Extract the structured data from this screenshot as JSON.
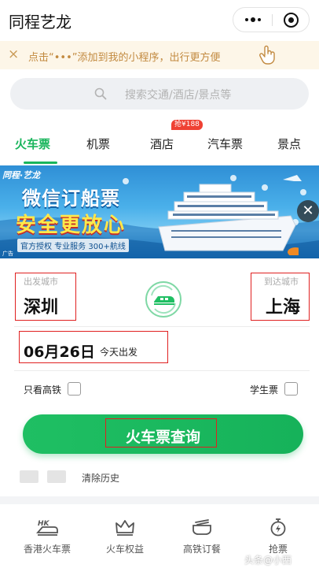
{
  "app_title": "同程艺龙",
  "tip_bar": {
    "close_glyph": "×",
    "text": "点击“•••”添加到我的小程序，出行更方便"
  },
  "search": {
    "placeholder": "搜索交通/酒店/景点等"
  },
  "tabs": [
    {
      "label": "火车票",
      "active": true
    },
    {
      "label": "机票"
    },
    {
      "label": "酒店",
      "badge": "抢¥188"
    },
    {
      "label": "汽车票"
    },
    {
      "label": "景点"
    }
  ],
  "banner": {
    "brand": "同程·艺龙",
    "headline": "微信订船票",
    "slogan": "安全更放心",
    "subline": "官方授权 专业服务 300+航线",
    "ad_tag": "广告",
    "close_glyph": "✕"
  },
  "booking": {
    "from_label": "出发城市",
    "from_city": "深圳",
    "to_label": "到达城市",
    "to_city": "上海",
    "date": "06月26日",
    "date_note": "今天出发",
    "hs_only_label": "只看高铁",
    "student_label": "学生票",
    "search_button": "火车票查询",
    "clear_history": "清除历史"
  },
  "quick_menu": [
    {
      "label": "香港火车票",
      "icon": "hk-train-icon"
    },
    {
      "label": "火车权益",
      "icon": "crown-icon"
    },
    {
      "label": "高铁订餐",
      "icon": "meal-icon"
    },
    {
      "label": "抢票",
      "icon": "stopwatch-icon"
    }
  ],
  "watermark": "头条@小西",
  "colors": {
    "accent": "#19b55c",
    "badge": "#ef4133",
    "tip_text": "#c28a40",
    "highlight": "#e02020"
  }
}
